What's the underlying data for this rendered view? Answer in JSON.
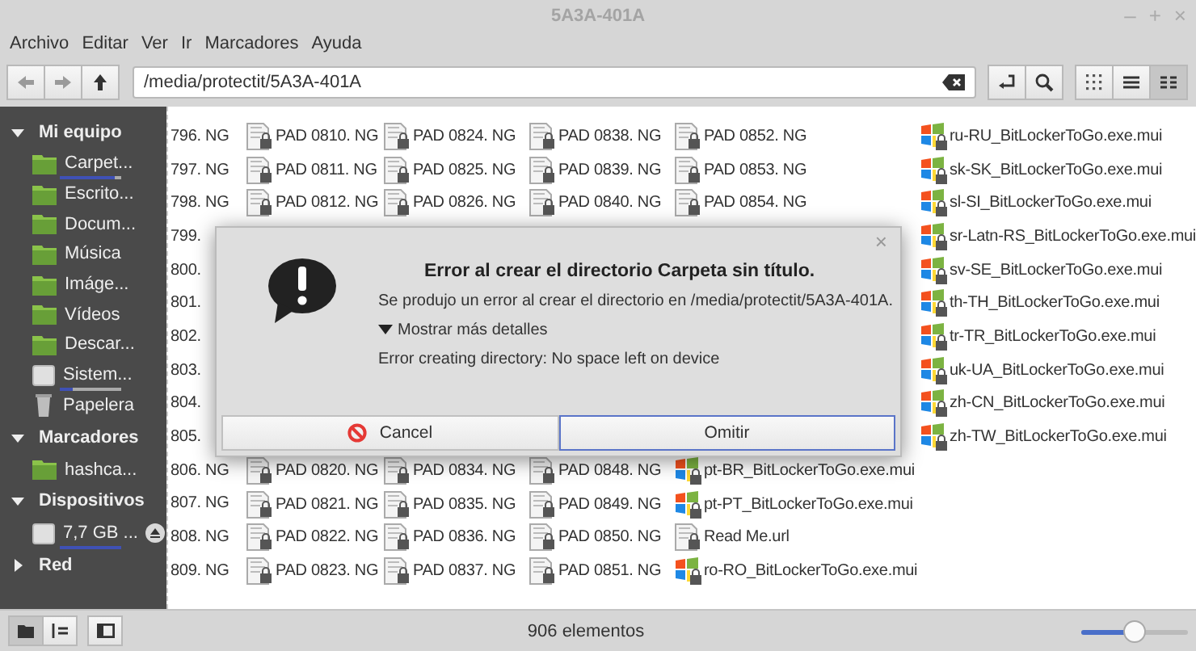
{
  "window": {
    "title": "5A3A-401A",
    "controls": [
      "–",
      "+",
      "×"
    ]
  },
  "menu": [
    "Archivo",
    "Editar",
    "Ver",
    "Ir",
    "Marcadores",
    "Ayuda"
  ],
  "toolbar": {
    "location": "/media/protectit/5A3A-401A",
    "views": [
      {
        "kind": "icons",
        "selected": false
      },
      {
        "kind": "list",
        "selected": false
      },
      {
        "kind": "compact",
        "selected": true
      }
    ]
  },
  "sidebar": [
    {
      "title": "Mi equipo",
      "expanded": true,
      "items": [
        {
          "label": "Carpet...",
          "kind": "folder",
          "level": 0.9
        },
        {
          "label": "Escrito...",
          "kind": "folder"
        },
        {
          "label": "Docum...",
          "kind": "folder"
        },
        {
          "label": "Música",
          "kind": "folder"
        },
        {
          "label": "Imáge...",
          "kind": "folder"
        },
        {
          "label": "Vídeos",
          "kind": "folder"
        },
        {
          "label": "Descar...",
          "kind": "folder"
        },
        {
          "label": "Sistem...",
          "kind": "drive",
          "level": 0.2
        },
        {
          "label": "Papelera",
          "kind": "trash"
        }
      ]
    },
    {
      "title": "Marcadores",
      "expanded": true,
      "items": [
        {
          "label": "hashca...",
          "kind": "folder"
        }
      ]
    },
    {
      "title": "Dispositivos",
      "expanded": true,
      "items": [
        {
          "label": "7,7 GB ...",
          "kind": "drive",
          "level": 1,
          "eject": true
        }
      ]
    },
    {
      "title": "Red",
      "expanded": false
    }
  ],
  "file_columns": [
    {
      "top": [
        {
          "name": "796. NG"
        },
        {
          "name": "797. NG"
        },
        {
          "name": "798. NG"
        },
        {
          "name": "799."
        },
        {
          "name": "800."
        },
        {
          "name": "801."
        },
        {
          "name": "802."
        },
        {
          "name": "803."
        },
        {
          "name": "804."
        },
        {
          "name": "805."
        },
        {
          "name": "806. NG"
        },
        {
          "name": "807. NG"
        },
        {
          "name": "808. NG"
        },
        {
          "name": "809. NG"
        }
      ]
    },
    {
      "top": [
        {
          "name": "PAD 0810. NG",
          "kind": "document"
        },
        {
          "name": "PAD 0811. NG",
          "kind": "document"
        },
        {
          "name": "PAD 0812. NG",
          "kind": "document"
        }
      ],
      "bottom": [
        {
          "name": "PAD 0820. NG",
          "kind": "document"
        },
        {
          "name": "PAD 0821. NG",
          "kind": "document"
        },
        {
          "name": "PAD 0822. NG",
          "kind": "document"
        },
        {
          "name": "PAD 0823. NG",
          "kind": "document"
        }
      ]
    },
    {
      "top": [
        {
          "name": "PAD 0824. NG",
          "kind": "document"
        },
        {
          "name": "PAD 0825. NG",
          "kind": "document"
        },
        {
          "name": "PAD 0826. NG",
          "kind": "document"
        }
      ],
      "bottom": [
        {
          "name": "PAD 0834. NG",
          "kind": "document"
        },
        {
          "name": "PAD 0835. NG",
          "kind": "document"
        },
        {
          "name": "PAD 0836. NG",
          "kind": "document"
        },
        {
          "name": "PAD 0837. NG",
          "kind": "document"
        }
      ]
    },
    {
      "top": [
        {
          "name": "PAD 0838. NG",
          "kind": "document"
        },
        {
          "name": "PAD 0839. NG",
          "kind": "document"
        },
        {
          "name": "PAD 0840. NG",
          "kind": "document"
        }
      ],
      "bottom": [
        {
          "name": "PAD 0848. NG",
          "kind": "document"
        },
        {
          "name": "PAD 0849. NG",
          "kind": "document"
        },
        {
          "name": "PAD 0850. NG",
          "kind": "document"
        },
        {
          "name": "PAD 0851. NG",
          "kind": "document"
        }
      ]
    },
    {
      "top": [
        {
          "name": "PAD 0852. NG",
          "kind": "document"
        },
        {
          "name": "PAD 0853. NG",
          "kind": "document"
        },
        {
          "name": "PAD 0854. NG",
          "kind": "document"
        }
      ],
      "bottom": [
        {
          "name": "pt-BR_BitLockerToGo.exe.mui",
          "kind": "program"
        },
        {
          "name": "pt-PT_BitLockerToGo.exe.mui",
          "kind": "program"
        },
        {
          "name": "Read Me.url",
          "kind": "document"
        },
        {
          "name": "ro-RO_BitLockerToGo.exe.mui",
          "kind": "program"
        }
      ]
    },
    {
      "top": [
        {
          "name": "ru-RU_BitLockerToGo.exe.mui",
          "kind": "program"
        },
        {
          "name": "sk-SK_BitLockerToGo.exe.mui",
          "kind": "program"
        },
        {
          "name": "sl-SI_BitLockerToGo.exe.mui",
          "kind": "program"
        },
        {
          "name": "sr-Latn-RS_BitLockerToGo.exe.mui",
          "kind": "program"
        },
        {
          "name": "sv-SE_BitLockerToGo.exe.mui",
          "kind": "program"
        },
        {
          "name": "th-TH_BitLockerToGo.exe.mui",
          "kind": "program"
        },
        {
          "name": "tr-TR_BitLockerToGo.exe.mui",
          "kind": "program"
        },
        {
          "name": "uk-UA_BitLockerToGo.exe.mui",
          "kind": "program"
        },
        {
          "name": "zh-CN_BitLockerToGo.exe.mui",
          "kind": "program"
        },
        {
          "name": "zh-TW_BitLockerToGo.exe.mui",
          "kind": "program"
        }
      ]
    }
  ],
  "status_bar": {
    "text": "906 elementos",
    "zoom": {
      "level": 0.5
    }
  },
  "dialog": {
    "close": "×",
    "title": "Error al crear el directorio Carpeta sin título.",
    "message": "Se produjo un error al crear el directorio en /media/protectit/5A3A-401A.",
    "details_toggle": {
      "label": "Mostrar más detalles",
      "expanded": true
    },
    "details": "Error creating directory: No space left on device",
    "buttons": [
      {
        "label": "Cancel",
        "kind": "cancel",
        "focused": false
      },
      {
        "label": "Omitir",
        "kind": "plain",
        "focused": true
      }
    ]
  }
}
